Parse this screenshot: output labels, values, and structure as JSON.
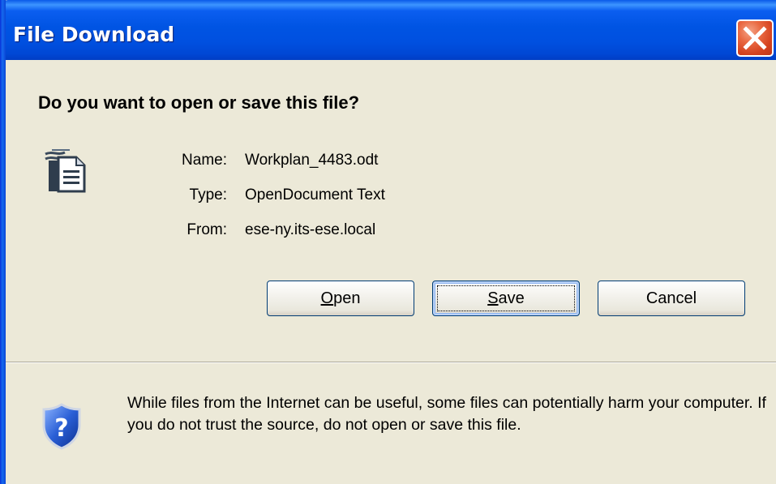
{
  "window": {
    "title": "File Download",
    "close_icon": "close-icon"
  },
  "dialog": {
    "heading": "Do you want to open or save this file?",
    "file_icon": "document-icon",
    "name_label": "Name:",
    "name_value": "Workplan_4483.odt",
    "type_label": "Type:",
    "type_value": "OpenDocument Text",
    "from_label": "From:",
    "from_value": "ese-ny.its-ese.local"
  },
  "buttons": {
    "open_underline": "O",
    "open_rest": "pen",
    "save_underline": "S",
    "save_rest": "ave",
    "cancel": "Cancel"
  },
  "warning": {
    "icon": "shield-question-icon",
    "text": "While files from the Internet can be useful, some files can potentially harm your computer. If you do not trust the source, do not open or save this file."
  },
  "colors": {
    "titlebar": "#0054e3",
    "dialog_bg": "#ece9d8",
    "close_button": "#d5421f",
    "button_border": "#003c74"
  }
}
